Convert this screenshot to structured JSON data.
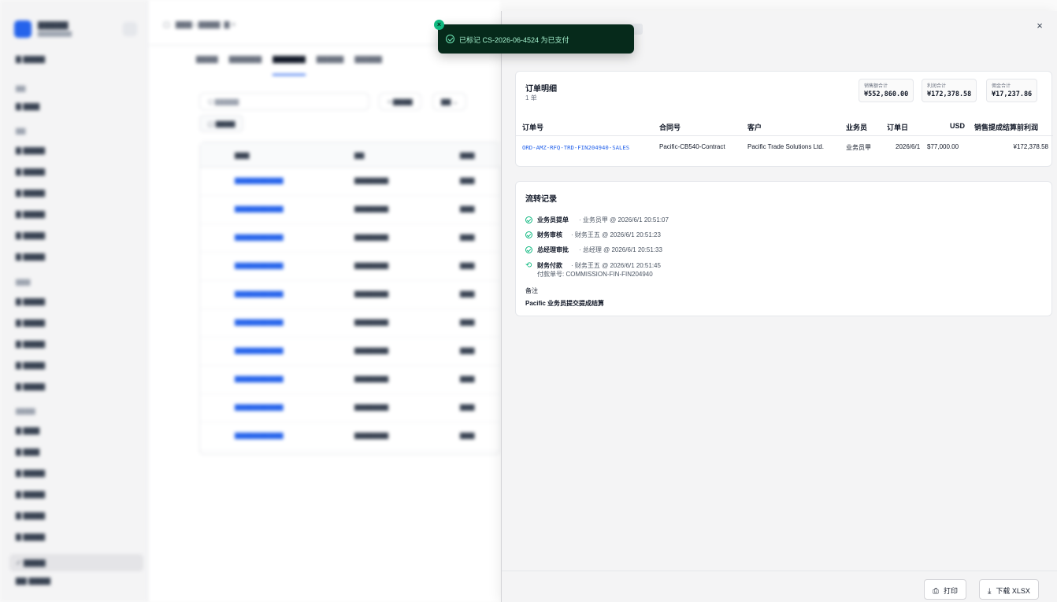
{
  "toast": {
    "message": "已标记 CS-2026-06-4524 为已支付",
    "icon": "check-circle-icon",
    "accent": "#6ee7b7",
    "background": "#062a1b"
  },
  "drawer": {
    "close_label": "×",
    "orders": {
      "title": "订单明细",
      "count": "1 单",
      "stats": [
        {
          "label": "销售额合计",
          "value": "¥552,860.00"
        },
        {
          "label": "利润合计",
          "value": "¥172,378.58"
        },
        {
          "label": "佣金合计",
          "value": "¥17,237.86"
        }
      ],
      "columns": [
        "订单号",
        "合同号",
        "客户",
        "业务员",
        "订单日",
        "USD",
        "销售提成结算前利润"
      ],
      "rows": [
        {
          "order_no": "ORD-AMZ-RFQ-TRD-FIN204940-SALES",
          "contract_no": "Pacific-CB540-Contract",
          "customer": "Pacific Trade Solutions Ltd.",
          "salesperson": "业务员甲",
          "order_date": "2026/6/1",
          "usd": "$77,000.00",
          "profit": "¥172,378.58"
        }
      ]
    },
    "flow": {
      "title": "流转记录",
      "steps": [
        {
          "step": "业务员提单",
          "meta": "· 业务员甲 @ 2026/6/1 20:51:07",
          "icon": "check-circle-icon"
        },
        {
          "step": "财务审核",
          "meta": "· 财务王五 @ 2026/6/1 20:51:23",
          "icon": "check-circle-icon"
        },
        {
          "step": "总经理审批",
          "meta": "· 总经理 @ 2026/6/1 20:51:33",
          "icon": "check-circle-icon"
        },
        {
          "step": "财务付款",
          "meta": "· 财务王五 @ 2026/6/1 20:51:45",
          "sub": "付款单号: COMMISSION-FIN-FIN204940",
          "icon": "payment-icon"
        }
      ],
      "note_label": "备注",
      "note_text": "Pacific 业务员提交提成结算"
    },
    "footer": {
      "print_label": "打印",
      "download_label": "下载 XLSX"
    }
  },
  "colors": {
    "link": "#2563eb",
    "success": "#10b981"
  }
}
